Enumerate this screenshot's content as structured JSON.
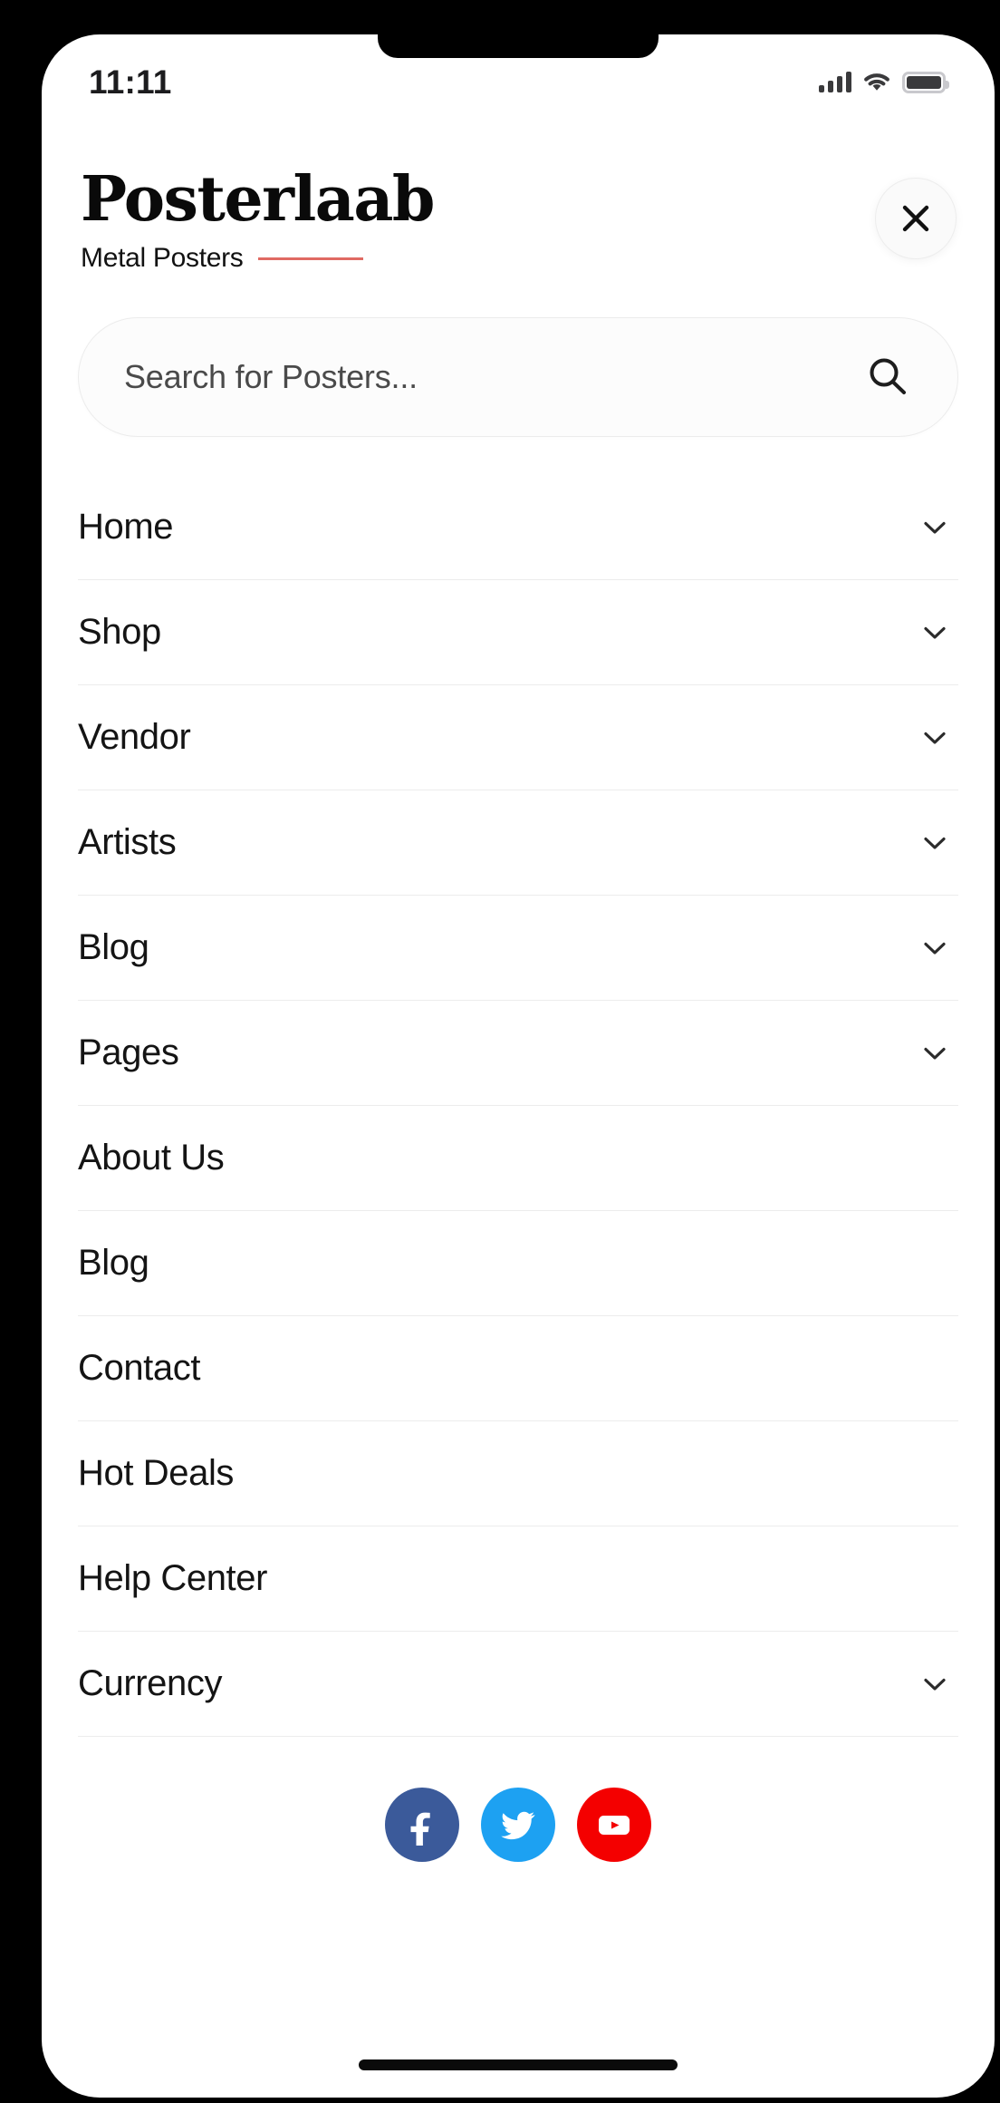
{
  "status_bar": {
    "time": "11:11",
    "cellular_icon": "signal-bars-icon",
    "wifi_icon": "wifi-icon",
    "battery_icon": "battery-full-icon"
  },
  "header": {
    "brand_name": "Posterlaab",
    "brand_tagline": "Metal Posters",
    "accent_color": "#e06a63",
    "close_icon": "close-icon"
  },
  "search": {
    "placeholder": "Search for Posters...",
    "value": "",
    "icon": "search-icon"
  },
  "menu": {
    "items": [
      {
        "label": "Home",
        "has_chevron": true
      },
      {
        "label": "Shop",
        "has_chevron": true
      },
      {
        "label": "Vendor",
        "has_chevron": true
      },
      {
        "label": "Artists",
        "has_chevron": true
      },
      {
        "label": "Blog",
        "has_chevron": true
      },
      {
        "label": "Pages",
        "has_chevron": true
      },
      {
        "label": "About Us",
        "has_chevron": false
      },
      {
        "label": "Blog",
        "has_chevron": false
      },
      {
        "label": "Contact",
        "has_chevron": false
      },
      {
        "label": "Hot Deals",
        "has_chevron": false
      },
      {
        "label": "Help Center",
        "has_chevron": false
      },
      {
        "label": "Currency",
        "has_chevron": true
      }
    ],
    "chevron_icon": "chevron-down-icon"
  },
  "social": {
    "items": [
      {
        "name": "facebook",
        "icon": "facebook-icon",
        "color": "#3b5a9a"
      },
      {
        "name": "twitter",
        "icon": "twitter-icon",
        "color": "#1da1f2"
      },
      {
        "name": "youtube",
        "icon": "youtube-icon",
        "color": "#f40000"
      }
    ]
  }
}
